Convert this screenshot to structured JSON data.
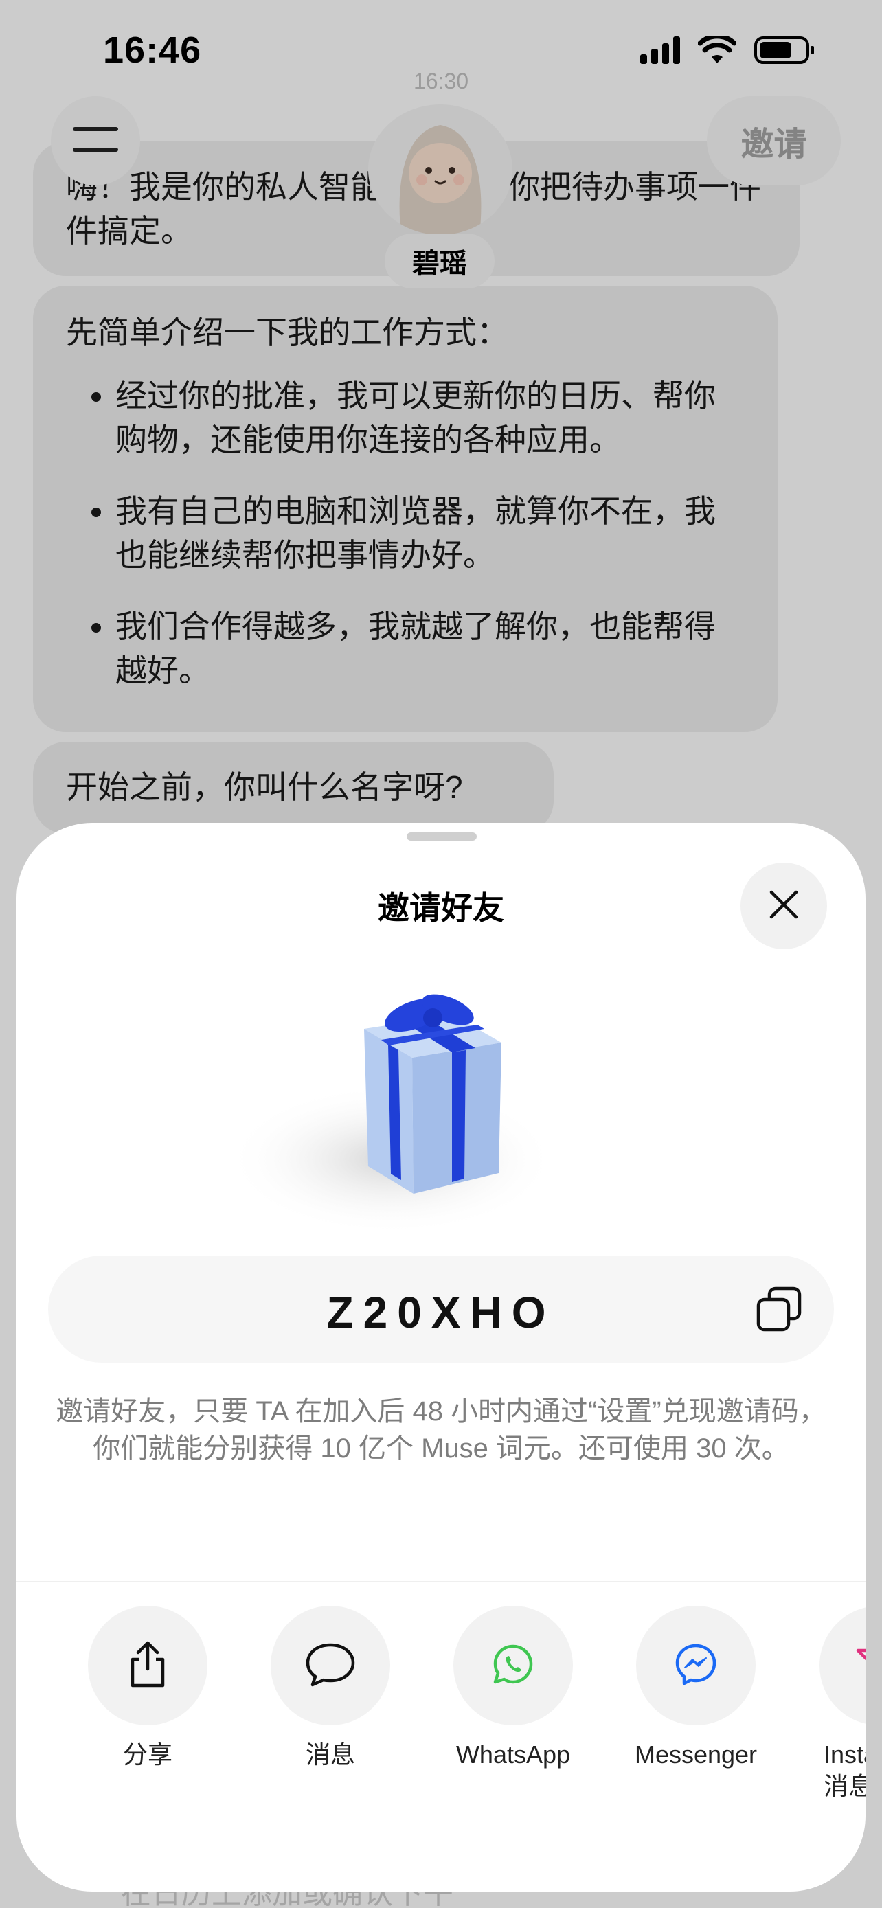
{
  "status_bar": {
    "time": "16:46"
  },
  "chat": {
    "timestamp": "16:30",
    "header": {
      "menu_icon": "hamburger-icon",
      "invite_label": "邀请",
      "assistant_name": "碧瑶"
    },
    "messages": [
      {
        "text": "嗨！我是你的私人智能助理，帮你把待办事项一件件搞定。"
      },
      {
        "intro": "先简单介绍一下我的工作方式：",
        "bullets": [
          "经过你的批准，我可以更新你的日历、帮你购物，还能使用你连接的各种应用。",
          "我有自己的电脑和浏览器，就算你不在，我也能继续帮你把事情办好。",
          "我们合作得越多，我就越了解你，也能帮得越好。"
        ]
      },
      {
        "text": "开始之前，你叫什么名字呀?"
      }
    ],
    "behind_text": "在日历上添加或确认下午"
  },
  "sheet": {
    "title": "邀请好友",
    "close_icon": "close-icon",
    "gift_icon": "gift-icon",
    "invite_code": "Z20XHO",
    "copy_icon": "copy-icon",
    "description": "邀请好友，只要 TA 在加入后 48 小时内通过“设置”兑现邀请码，你们就能分别获得 10 亿个 Muse 词元。还可使用 30 次。",
    "share_targets": [
      {
        "label": "分享",
        "icon": "share-icon"
      },
      {
        "label": "消息",
        "icon": "message-icon"
      },
      {
        "label": "WhatsApp",
        "icon": "whatsapp-icon"
      },
      {
        "label": "Messenger",
        "icon": "messenger-icon"
      },
      {
        "label": "Instagram 消息",
        "icon": "instagram-icon"
      }
    ]
  },
  "colors": {
    "gift_box": "#b5cbf0",
    "ribbon": "#1f3fd6",
    "whatsapp": "#3fc651",
    "messenger": "#1b6af5",
    "instagram": "#e0327f"
  }
}
